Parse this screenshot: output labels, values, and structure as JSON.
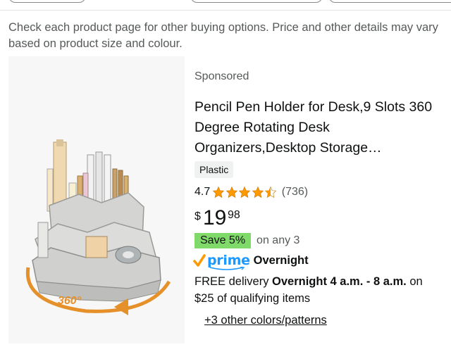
{
  "notice": "Check each product page for other buying options. Price and other details may vary based on product size and colour.",
  "product": {
    "sponsored": "Sponsored",
    "title": "Pencil Pen Holder for Desk,9 Slots 360 Degree Rotating Desk Organizers,Desktop Storage…",
    "material_badge": "Plastic",
    "rating_value": "4.7",
    "rating_stars": 4.5,
    "rating_count": "(736)",
    "price_symbol": "$",
    "price_whole": "19",
    "price_fraction": "98",
    "save_badge": "Save 5%",
    "save_suffix": "on any 3",
    "prime_label": "prime",
    "prime_speed": "Overnight",
    "delivery_prefix": "FREE delivery ",
    "delivery_bold": "Overnight 4 a.m. - 8 a.m.",
    "delivery_suffix": " on $25 of qualifying items",
    "more_colors": "+3 other colors/patterns",
    "image_label": "360°"
  },
  "colors": {
    "star": "#ff9900",
    "save_badge": "#7fda69",
    "prime": "#1a98ff",
    "prime_check": "#ff9900",
    "muted_text": "#565959"
  }
}
